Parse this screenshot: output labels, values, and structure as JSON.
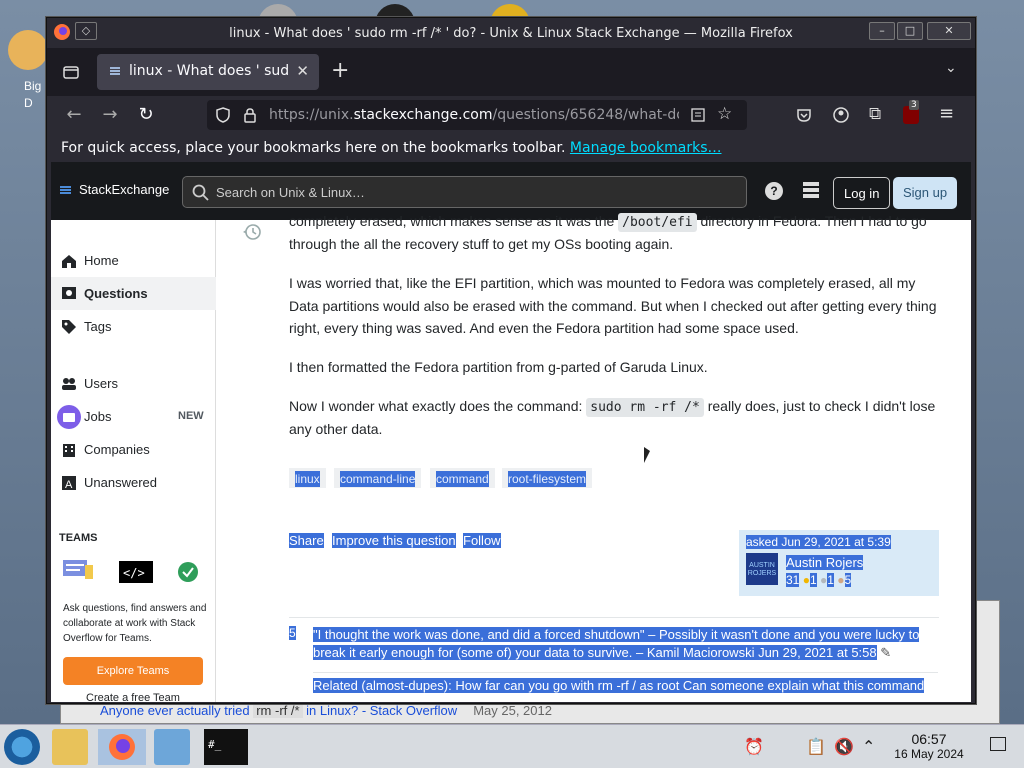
{
  "window": {
    "title": "linux - What does ' sudo rm -rf /* ' do? - Unix & Linux Stack Exchange — Mozilla Firefox"
  },
  "tab": {
    "label": "linux - What does ' sudo rm"
  },
  "url": {
    "prefix": "https://unix.",
    "domain": "stackexchange.com",
    "path": "/questions/656248/what-do"
  },
  "bookmarks_bar": {
    "text": "For quick access, place your bookmarks here on the bookmarks toolbar.",
    "link": "Manage bookmarks…"
  },
  "extension_badge": "3",
  "se_header": {
    "logo": "StackExchange",
    "search_placeholder": "Search on Unix & Linux…",
    "login": "Log in",
    "signup": "Sign up"
  },
  "sidebar": {
    "items": [
      {
        "label": "Home",
        "icon": "home-icon"
      },
      {
        "label": "Questions",
        "icon": "questions-icon"
      },
      {
        "label": "Tags",
        "icon": "tag-icon"
      },
      {
        "label": "Users",
        "icon": "users-icon"
      },
      {
        "label": "Jobs",
        "icon": "jobs-icon",
        "badge": "NEW"
      },
      {
        "label": "Companies",
        "icon": "companies-icon"
      },
      {
        "label": "Unanswered",
        "icon": "unanswered-icon"
      }
    ],
    "teams_heading": "TEAMS",
    "teams_text": "Ask questions, find answers and collaborate at work with Stack Overflow for Teams.",
    "explore_button": "Explore Teams",
    "create_team": "Create a free Team"
  },
  "post": {
    "p0_before": "completely erased, which makes sense as it was the",
    "p0_code": "/boot/efi",
    "p0_after": "directory in Fedora. Then I had to go through the all the recovery stuff to get my OSs booting again.",
    "p1": "I was worried that, like the EFI partition, which was mounted to Fedora was completely erased, all my Data partitions would also be erased with the command. But when I checked out after getting every thing right, every thing was saved. And even the Fedora partition had some space used.",
    "p2": "I then formatted the Fedora partition from g-parted of Garuda Linux.",
    "p3_before": "Now I wonder what exactly does the command:",
    "p3_code": "sudo rm -rf /*",
    "p3_after": "really does, just to check I didn't lose any other data."
  },
  "tags": [
    "linux",
    "command-line",
    "command",
    "root-filesystem"
  ],
  "actions": {
    "share": "Share",
    "improve": "Improve this question",
    "follow": "Follow"
  },
  "asker": {
    "asked": "asked Jun 29, 2021 at 5:39",
    "name": "Austin Rojers",
    "avatar_text": "AUSTIN ROJERS",
    "rep": "31",
    "gold": "1",
    "silver": "1",
    "bronze": "5"
  },
  "comments": [
    {
      "score": "5",
      "text": "\"I thought the work was done, and did a forced shutdown\" – Possibly it wasn't done and you were lucky to break it early enough for (some of) your data to survive. – Kamil Maciorowski Jun 29, 2021 at 5:58"
    },
    {
      "score": "",
      "text": "Related (almost-dupes): How far can you go with rm -rf / as root Can someone explain what this command"
    }
  ],
  "background_window": {
    "link": "Anyone ever actually tried",
    "code": "rm -rf /*",
    "rest": "in Linux? - Stack Overflow",
    "date": "May 25, 2012"
  },
  "desktop_icon_label": "Big D",
  "taskbar": {
    "time": "06:57",
    "date": "16 May 2024"
  }
}
